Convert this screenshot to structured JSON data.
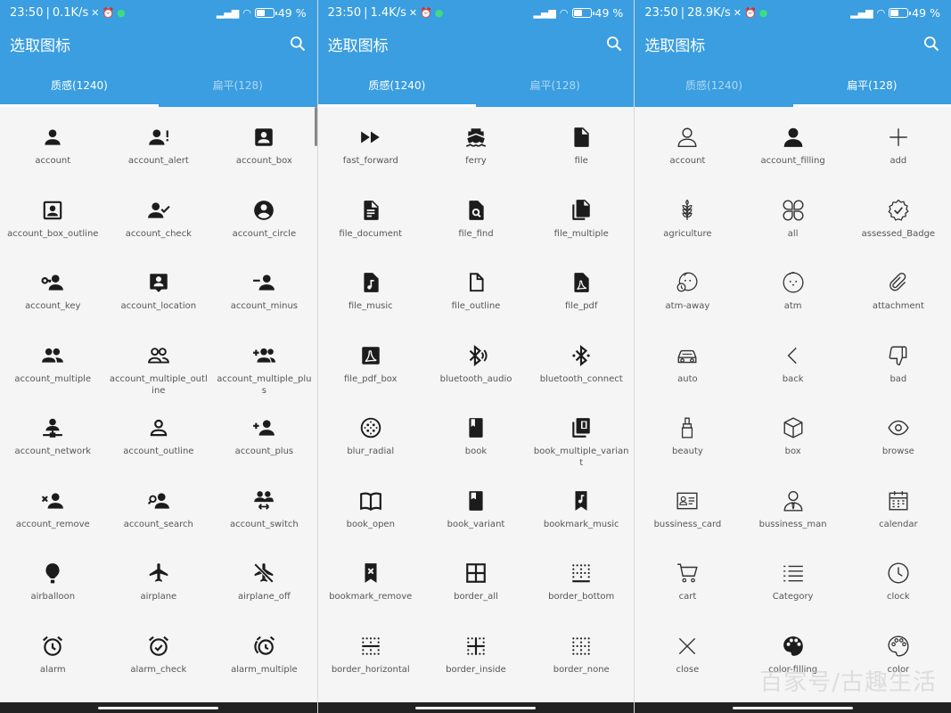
{
  "screens": [
    {
      "status": {
        "time": "23:50",
        "speed": "0.1K/s",
        "battery": "49"
      },
      "title": "选取图标",
      "tabs": [
        {
          "label": "质感(1240)",
          "active": true
        },
        {
          "label": "扁平(128)",
          "active": false
        }
      ],
      "icons": [
        {
          "name": "account",
          "icon": "account"
        },
        {
          "name": "account_alert",
          "icon": "account_alert"
        },
        {
          "name": "account_box",
          "icon": "account_box"
        },
        {
          "name": "account_box_outline",
          "icon": "account_box_outline"
        },
        {
          "name": "account_check",
          "icon": "account_check"
        },
        {
          "name": "account_circle",
          "icon": "account_circle"
        },
        {
          "name": "account_key",
          "icon": "account_key"
        },
        {
          "name": "account_location",
          "icon": "account_location"
        },
        {
          "name": "account_minus",
          "icon": "account_minus"
        },
        {
          "name": "account_multiple",
          "icon": "account_multiple"
        },
        {
          "name": "account_multiple_outline",
          "icon": "account_multiple_outline"
        },
        {
          "name": "account_multiple_plus",
          "icon": "account_multiple_plus"
        },
        {
          "name": "account_network",
          "icon": "account_network"
        },
        {
          "name": "account_outline",
          "icon": "account_outline"
        },
        {
          "name": "account_plus",
          "icon": "account_plus"
        },
        {
          "name": "account_remove",
          "icon": "account_remove"
        },
        {
          "name": "account_search",
          "icon": "account_search"
        },
        {
          "name": "account_switch",
          "icon": "account_switch"
        },
        {
          "name": "airballoon",
          "icon": "airballoon"
        },
        {
          "name": "airplane",
          "icon": "airplane"
        },
        {
          "name": "airplane_off",
          "icon": "airplane_off"
        },
        {
          "name": "alarm",
          "icon": "alarm"
        },
        {
          "name": "alarm_check",
          "icon": "alarm_check"
        },
        {
          "name": "alarm_multiple",
          "icon": "alarm_multiple"
        }
      ]
    },
    {
      "status": {
        "time": "23:50",
        "speed": "1.4K/s",
        "battery": "49"
      },
      "title": "选取图标",
      "tabs": [
        {
          "label": "质感(1240)",
          "active": true
        },
        {
          "label": "扁平(128)",
          "active": false
        }
      ],
      "icons": [
        {
          "name": "fast_forward",
          "icon": "fast_forward"
        },
        {
          "name": "ferry",
          "icon": "ferry"
        },
        {
          "name": "file",
          "icon": "file"
        },
        {
          "name": "file_document",
          "icon": "file_document"
        },
        {
          "name": "file_find",
          "icon": "file_find"
        },
        {
          "name": "file_multiple",
          "icon": "file_multiple"
        },
        {
          "name": "file_music",
          "icon": "file_music"
        },
        {
          "name": "file_outline",
          "icon": "file_outline"
        },
        {
          "name": "file_pdf",
          "icon": "file_pdf"
        },
        {
          "name": "file_pdf_box",
          "icon": "file_pdf_box"
        },
        {
          "name": "bluetooth_audio",
          "icon": "bluetooth_audio"
        },
        {
          "name": "bluetooth_connect",
          "icon": "bluetooth_connect"
        },
        {
          "name": "blur_radial",
          "icon": "blur_radial"
        },
        {
          "name": "book",
          "icon": "book"
        },
        {
          "name": "book_multiple_variant",
          "icon": "book_multiple_variant"
        },
        {
          "name": "book_open",
          "icon": "book_open"
        },
        {
          "name": "book_variant",
          "icon": "book_variant"
        },
        {
          "name": "bookmark_music",
          "icon": "bookmark_music"
        },
        {
          "name": "bookmark_remove",
          "icon": "bookmark_remove"
        },
        {
          "name": "border_all",
          "icon": "border_all"
        },
        {
          "name": "border_bottom",
          "icon": "border_bottom"
        },
        {
          "name": "border_horizontal",
          "icon": "border_horizontal"
        },
        {
          "name": "border_inside",
          "icon": "border_inside"
        },
        {
          "name": "border_none",
          "icon": "border_none"
        }
      ]
    },
    {
      "status": {
        "time": "23:50",
        "speed": "28.9K/s",
        "battery": "49"
      },
      "title": "选取图标",
      "tabs": [
        {
          "label": "质感(1240)",
          "active": false
        },
        {
          "label": "扁平(128)",
          "active": true
        }
      ],
      "icons": [
        {
          "name": "account",
          "icon": "flat_account"
        },
        {
          "name": "account_filling",
          "icon": "flat_account_filling"
        },
        {
          "name": "add",
          "icon": "flat_add"
        },
        {
          "name": "agriculture",
          "icon": "flat_agriculture"
        },
        {
          "name": "all",
          "icon": "flat_all"
        },
        {
          "name": "assessed_Badge",
          "icon": "flat_badge"
        },
        {
          "name": "atm-away",
          "icon": "flat_atm_away"
        },
        {
          "name": "atm",
          "icon": "flat_atm"
        },
        {
          "name": "attachment",
          "icon": "flat_attachment"
        },
        {
          "name": "auto",
          "icon": "flat_auto"
        },
        {
          "name": "back",
          "icon": "flat_back"
        },
        {
          "name": "bad",
          "icon": "flat_bad"
        },
        {
          "name": "beauty",
          "icon": "flat_beauty"
        },
        {
          "name": "box",
          "icon": "flat_box"
        },
        {
          "name": "browse",
          "icon": "flat_browse"
        },
        {
          "name": "bussiness_card",
          "icon": "flat_card"
        },
        {
          "name": "bussiness_man",
          "icon": "flat_man"
        },
        {
          "name": "calendar",
          "icon": "flat_calendar"
        },
        {
          "name": "cart",
          "icon": "flat_cart"
        },
        {
          "name": "Category",
          "icon": "flat_category"
        },
        {
          "name": "clock",
          "icon": "flat_clock"
        },
        {
          "name": "close",
          "icon": "flat_close"
        },
        {
          "name": "color-filling",
          "icon": "flat_palette_fill"
        },
        {
          "name": "color",
          "icon": "flat_palette"
        }
      ]
    }
  ],
  "watermark": "百家号/古趣生活"
}
